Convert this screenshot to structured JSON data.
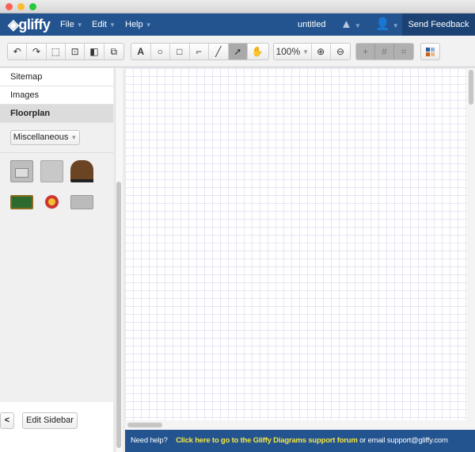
{
  "window": {
    "controls": {
      "close": "#fc5f57",
      "minimize": "#fdbc2e",
      "maximize": "#29c840"
    }
  },
  "nav": {
    "logo": "gliffy",
    "menus": [
      {
        "label": "File"
      },
      {
        "label": "Edit"
      },
      {
        "label": "Help"
      }
    ],
    "title": "untitled",
    "drive_icon": "google-drive-icon",
    "user_icon": "user-icon",
    "feedback": "Send Feedback"
  },
  "toolbar": {
    "group1": [
      "undo-icon",
      "redo-icon",
      "select-all-icon",
      "group-icon",
      "bring-front-icon",
      "send-back-icon"
    ],
    "group2": [
      {
        "icon": "text-icon",
        "glyph": "A"
      },
      {
        "icon": "ellipse-icon",
        "glyph": "○"
      },
      {
        "icon": "rectangle-icon",
        "glyph": "□"
      },
      {
        "icon": "connector-icon",
        "glyph": "⌐"
      },
      {
        "icon": "line-icon",
        "glyph": "╱"
      },
      {
        "icon": "pointer-icon",
        "glyph": "➚",
        "active": true
      },
      {
        "icon": "hand-icon",
        "glyph": "✋"
      }
    ],
    "zoom": "100%",
    "group4": [
      {
        "icon": "guides-icon",
        "glyph": "+"
      },
      {
        "icon": "grid-icon",
        "glyph": "#"
      },
      {
        "icon": "snap-icon",
        "glyph": "⌗"
      }
    ],
    "theme_icon": "theme-icon"
  },
  "sidebar": {
    "items": [
      {
        "label": "Sitemap"
      },
      {
        "label": "Images"
      },
      {
        "label": "Floorplan",
        "active": true
      }
    ],
    "category": "Miscellaneous",
    "shapes": [
      "oven",
      "dishwasher",
      "piano",
      "pool-table",
      "drum-kit",
      "fireplace"
    ],
    "collapse": "<",
    "edit": "Edit Sidebar"
  },
  "footer": {
    "prefix": "Need help?",
    "link": "Click here to go to the Gliffy Diagrams support forum",
    "suffix": "or email support@gliffy.com"
  },
  "colors": {
    "brand": "#23548f",
    "link": "#f4e642"
  }
}
